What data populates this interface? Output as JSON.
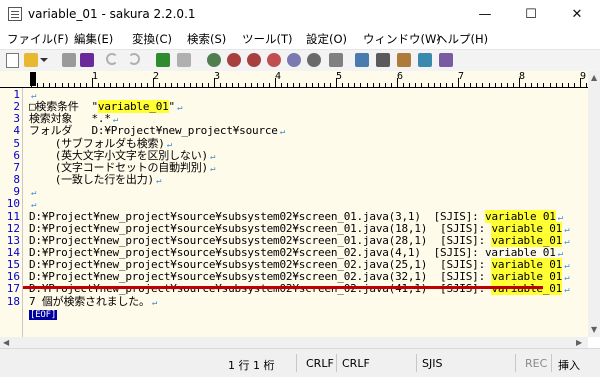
{
  "window": {
    "title": "variable_01 - sakura 2.2.0.1",
    "minimize": "—",
    "maximize": "☐",
    "close": "✕"
  },
  "menu": [
    "ファイル(F)",
    "編集(E)",
    "変換(C)",
    "検索(S)",
    "ツール(T)",
    "設定(O)",
    "ウィンドウ(W)",
    "ヘルプ(H)"
  ],
  "ruler": [
    "1",
    "2",
    "3",
    "4",
    "5",
    "6",
    "7",
    "8",
    "9"
  ],
  "lines": [
    {
      "n": "1",
      "text": ""
    },
    {
      "n": "2",
      "pre": "□検索条件  \"",
      "hl": "variable_01",
      "post": "\""
    },
    {
      "n": "3",
      "text": "検索対象   *.*"
    },
    {
      "n": "4",
      "text": "フォルダ   D:¥Project¥new_project¥source"
    },
    {
      "n": "5",
      "text": "    (サブフォルダも検索)"
    },
    {
      "n": "6",
      "text": "    (英大文字小文字を区別しない)"
    },
    {
      "n": "7",
      "text": "    (文字コードセットの自動判別)"
    },
    {
      "n": "8",
      "text": "    (一致した行を出力)"
    },
    {
      "n": "9",
      "text": ""
    },
    {
      "n": "10",
      "text": ""
    },
    {
      "n": "11",
      "pre": "D:¥Project¥new_project¥source¥subsystem02¥screen_01.java(3,1)  [SJIS]: ",
      "hl": "variable_01"
    },
    {
      "n": "12",
      "pre": "D:¥Project¥new_project¥source¥subsystem02¥screen_01.java(18,1)  [SJIS]: ",
      "hl": "variable_01"
    },
    {
      "n": "13",
      "pre": "D:¥Project¥new_project¥source¥subsystem02¥screen_01.java(28,1)  [SJIS]: ",
      "hl": "variable_01"
    },
    {
      "n": "14",
      "pre": "D:¥Project¥new_project¥source¥subsystem02¥screen_02.java(4,1)  [SJIS]: variable_01"
    },
    {
      "n": "15",
      "pre": "D:¥Project¥new_project¥source¥subsystem02¥screen_02.java(25,1)  [SJIS]: ",
      "hl": "variable_01"
    },
    {
      "n": "16",
      "pre": "D:¥Project¥new_project¥source¥subsystem02¥screen_02.java(32,1)  [SJIS]: ",
      "hl": "variable_01"
    },
    {
      "n": "17",
      "pre": "D:¥Project¥new_project¥source¥subsystem02¥screen_02.java(41,1)  [SJIS]: ",
      "hl": "variable_01"
    },
    {
      "n": "18",
      "text": "7 個が検索されました。"
    }
  ],
  "eof": "[EOF]",
  "status": {
    "position": "1 行   1 桁",
    "eol1": "CRLF",
    "eol2": "CRLF",
    "encoding": "SJIS",
    "rec": "REC",
    "insert": "挿入"
  },
  "colors": {
    "editor_bg": "#fffbea",
    "highlight": "#ffff33",
    "line_number": "#0000c8",
    "cursor_line": "#c00000",
    "eof_bg": "#0000a0"
  }
}
